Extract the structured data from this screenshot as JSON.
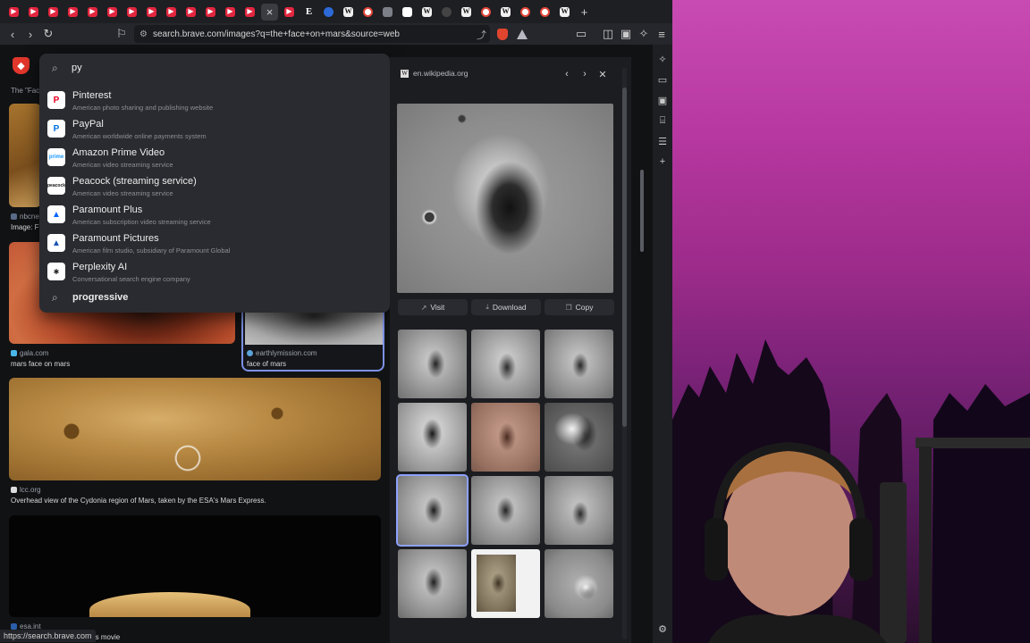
{
  "tabs": {
    "favicons": [
      "yt",
      "yt",
      "yt",
      "yt",
      "yt",
      "yt",
      "yt",
      "yt",
      "yt",
      "yt",
      "yt",
      "yt",
      "yt",
      "yt",
      "active-close",
      "yt",
      "blue",
      "w",
      "g",
      "grid",
      "gmail",
      "w",
      "wn",
      "w",
      "g",
      "w",
      "g",
      "g",
      "w"
    ]
  },
  "toolbar": {
    "url": "search.brave.com/images?q=the+face+on+mars&source=web"
  },
  "search": {
    "query": "py"
  },
  "suggestions": [
    {
      "title": "Pinterest",
      "subtitle": "American photo sharing and publishing website",
      "icon": "pinterest-icon",
      "color": "#e60023"
    },
    {
      "title": "PayPal",
      "subtitle": "American worldwide online payments system",
      "icon": "paypal-icon",
      "color": "#0070e0"
    },
    {
      "title": "Amazon Prime Video",
      "subtitle": "American video streaming service",
      "icon": "prime-video-icon",
      "color": "#1a98ff"
    },
    {
      "title": "Peacock (streaming service)",
      "subtitle": "American video streaming service",
      "icon": "peacock-icon",
      "color": "#111111"
    },
    {
      "title": "Paramount Plus",
      "subtitle": "American subscription video streaming service",
      "icon": "paramount-plus-icon",
      "color": "#0064ff"
    },
    {
      "title": "Paramount Pictures",
      "subtitle": "American film studio, subsidiary of Paramount Global",
      "icon": "paramount-pictures-icon",
      "color": "#1852b4"
    },
    {
      "title": "Perplexity AI",
      "subtitle": "Conversational search engine company",
      "icon": "perplexity-icon",
      "color": "#222222"
    }
  ],
  "query_suggestion": "progressive",
  "results": {
    "partial_top_label": "The \"Fac",
    "r1_source_partial": "nbcne",
    "r1_caption_partial": "Image: F",
    "r2_source": "gala.com",
    "r2_caption": "mars face on mars",
    "r3_source": "earthlymission.com",
    "r3_caption": "face of mars",
    "r4_source": "lcc.org",
    "r4_caption": "Overhead view of the Cydonia region of Mars, taken by the ESA's Mars Express.",
    "r5_source": "esa.int",
    "r5_caption_partial": "rs movie"
  },
  "viewer": {
    "domain": "en.wikipedia.org",
    "visit_label": "Visit",
    "download_label": "Download",
    "copy_label": "Copy"
  },
  "status": {
    "url": "https://search.brave.com"
  }
}
